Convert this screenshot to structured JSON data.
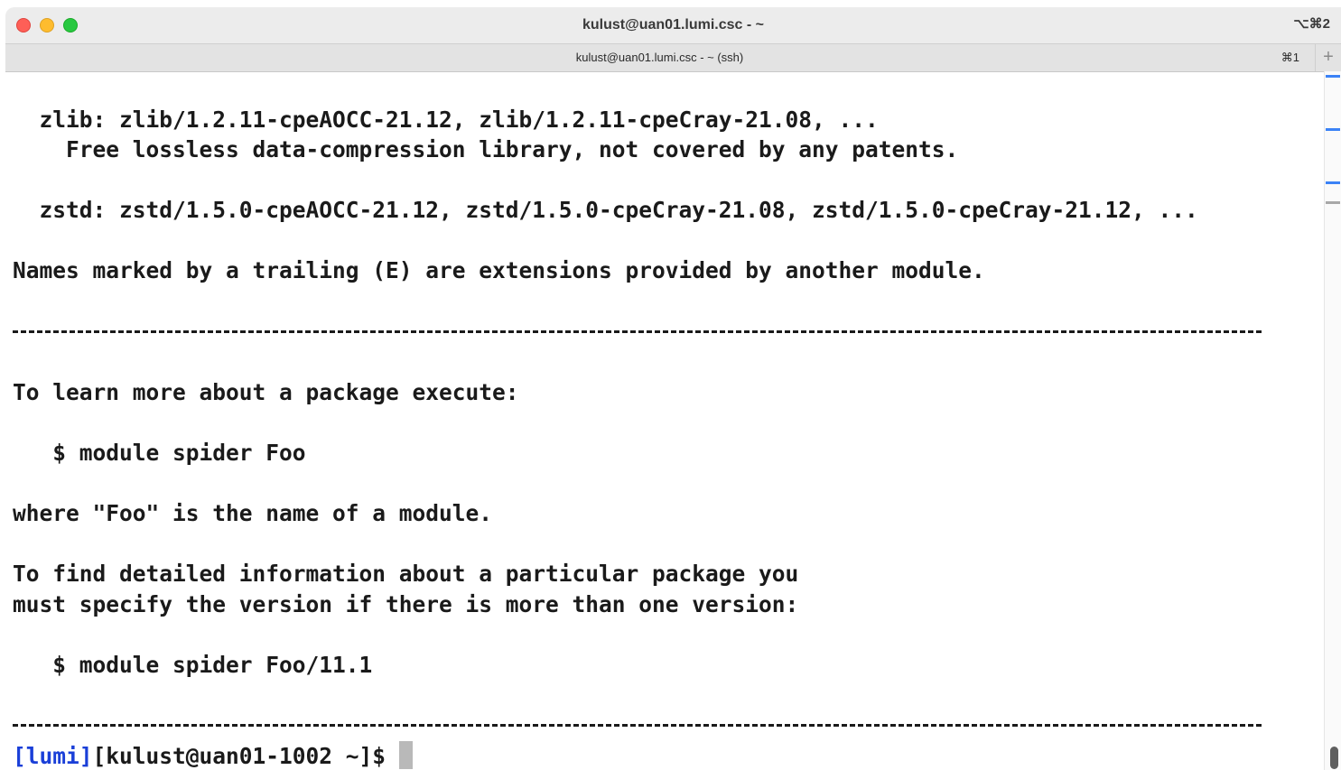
{
  "window": {
    "title": "kulust@uan01.lumi.csc - ~",
    "shortcut": "⌥⌘2"
  },
  "tab": {
    "label": "kulust@uan01.lumi.csc - ~ (ssh)",
    "shortcut": "⌘1",
    "new_tab": "+"
  },
  "terminal": {
    "lines": [
      "  zlib: zlib/1.2.11-cpeAOCC-21.12, zlib/1.2.11-cpeCray-21.08, ...",
      "    Free lossless data-compression library, not covered by any patents.",
      "  zstd: zstd/1.5.0-cpeAOCC-21.12, zstd/1.5.0-cpeCray-21.08, zstd/1.5.0-cpeCray-21.12, ...",
      "Names marked by a trailing (E) are extensions provided by another module.",
      "To learn more about a package execute:",
      "   $ module spider Foo",
      "where \"Foo\" is the name of a module.",
      "To find detailed information about a particular package you",
      "must specify the version if there is more than one version:",
      "   $ module spider Foo/11.1"
    ],
    "prompt": {
      "host_tag": "[lumi]",
      "user_host": "[kulust@uan01-1002 ~]$ "
    }
  },
  "colors": {
    "prompt_tag": "#1a3fd8",
    "text": "#1a1a1a",
    "cursor": "#b9b9b9"
  }
}
